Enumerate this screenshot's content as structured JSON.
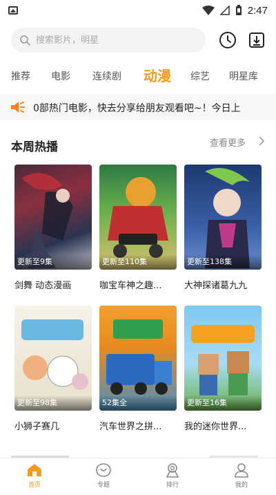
{
  "status_bar": {
    "time": "2:47"
  },
  "search": {
    "placeholder": "搜索影片，明星"
  },
  "tabs": [
    {
      "label": "推荐"
    },
    {
      "label": "电影"
    },
    {
      "label": "连续剧"
    },
    {
      "label": "动漫"
    },
    {
      "label": "综艺"
    },
    {
      "label": "明星库"
    }
  ],
  "active_tab": "动漫",
  "notice": {
    "text": "0部热门电影，快去分享给朋友观看吧~！今日上"
  },
  "section": {
    "title": "本周热播",
    "more_label": "查看更多"
  },
  "cards": [
    {
      "title": "剑舞 动态漫画",
      "badge": "更新至9集"
    },
    {
      "title": "咖宝车神之趣...",
      "badge": "更新至110集"
    },
    {
      "title": "大神探诸葛九九",
      "badge": "更新至138集"
    },
    {
      "title": "小狮子赛几",
      "badge": "更新至98集"
    },
    {
      "title": "汽车世界之拼...",
      "badge": "52集全"
    },
    {
      "title": "我的迷你世界...",
      "badge": "更新至16集"
    }
  ],
  "bottom_nav": [
    {
      "label": "首页"
    },
    {
      "label": "专题"
    },
    {
      "label": "排行"
    },
    {
      "label": "我的"
    }
  ],
  "colors": {
    "accent": "#f59a1f",
    "notice_icon": "#f5821f"
  },
  "icons": [
    "gallery-icon",
    "wifi-icon",
    "signal-icon",
    "battery-icon",
    "search-icon",
    "history-icon",
    "download-icon",
    "speaker-icon",
    "chevron-right-icon",
    "home-icon",
    "topic-icon",
    "ranking-icon",
    "profile-icon"
  ]
}
